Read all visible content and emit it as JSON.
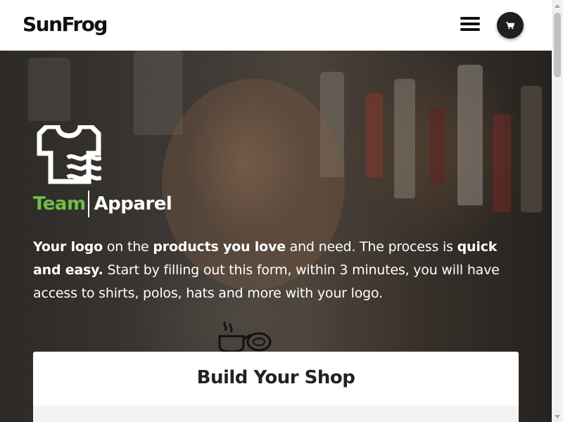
{
  "header": {
    "logo_text": "SunFrog",
    "menu_icon": "hamburger-menu-icon",
    "cart_icon": "shopping-cart-icon"
  },
  "hero": {
    "brand_icon": "shirt-wave-logo-icon",
    "brand_team": "Team",
    "brand_apparel": "Apparel",
    "intro_segments": [
      {
        "text": "Your logo",
        "bold": true
      },
      {
        "text": " on the ",
        "bold": false
      },
      {
        "text": "products you love",
        "bold": true
      },
      {
        "text": " and need. The process is ",
        "bold": false
      },
      {
        "text": "quick and easy.",
        "bold": true
      },
      {
        "text": " Start by filling out this form, within 3 minutes, you will have access to shirts, polos, hats and more with your logo.",
        "bold": false
      }
    ],
    "decor_icon": "cooking-pot-icon"
  },
  "card": {
    "title": "Build Your Shop"
  },
  "colors": {
    "accent_green": "#6cc04a",
    "header_bg": "#ffffff",
    "cart_button_bg": "#1f1f1f",
    "card_bg": "#ffffff",
    "field_bg": "#f2f2f2"
  }
}
